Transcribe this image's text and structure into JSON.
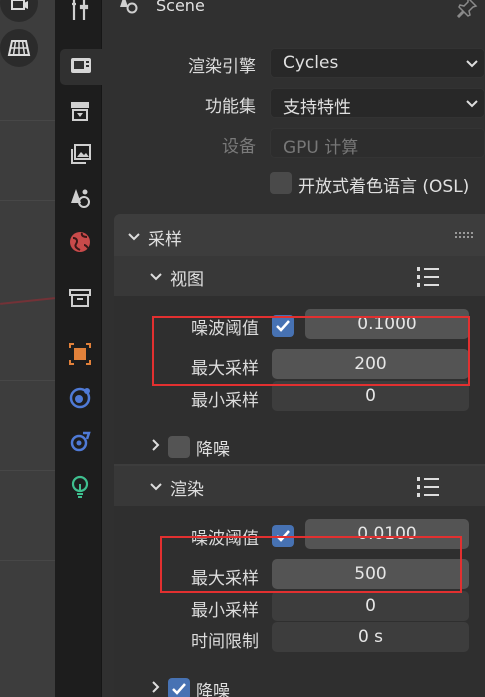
{
  "header": {
    "title": "Scene"
  },
  "tabs": [
    {
      "name": "tool-tab"
    },
    {
      "name": "render-tab"
    },
    {
      "name": "output-tab"
    },
    {
      "name": "view-layer-tab"
    },
    {
      "name": "scene-tab"
    },
    {
      "name": "world-tab"
    },
    {
      "name": "collection-tab"
    },
    {
      "name": "object-tab"
    },
    {
      "name": "modifier-tab"
    },
    {
      "name": "physics-tab"
    },
    {
      "name": "object-data-tab"
    }
  ],
  "render_settings": {
    "engine_label": "渲染引擎",
    "engine_value": "Cycles",
    "feature_set_label": "功能集",
    "feature_set_value": "支持特性",
    "device_label": "设备",
    "device_value": "GPU 计算",
    "osl_label": "开放式着色语言 (OSL)"
  },
  "sampling": {
    "title": "采样",
    "viewport": {
      "title": "视图",
      "noise_threshold_label": "噪波阈值",
      "noise_threshold_value": "0.1000",
      "max_samples_label": "最大采样",
      "max_samples_value": "200",
      "min_samples_label": "最小采样",
      "min_samples_value": "0",
      "denoise_label": "降噪"
    },
    "render": {
      "title": "渲染",
      "noise_threshold_label": "噪波阈值",
      "noise_threshold_value": "0.0100",
      "max_samples_label": "最大采样",
      "max_samples_value": "500",
      "min_samples_label": "最小采样",
      "min_samples_value": "0",
      "time_limit_label": "时间限制",
      "time_limit_value": "0 s",
      "denoise_label": "降噪"
    }
  },
  "colors": {
    "accent": "#4772b3",
    "highlight": "#e23030"
  }
}
